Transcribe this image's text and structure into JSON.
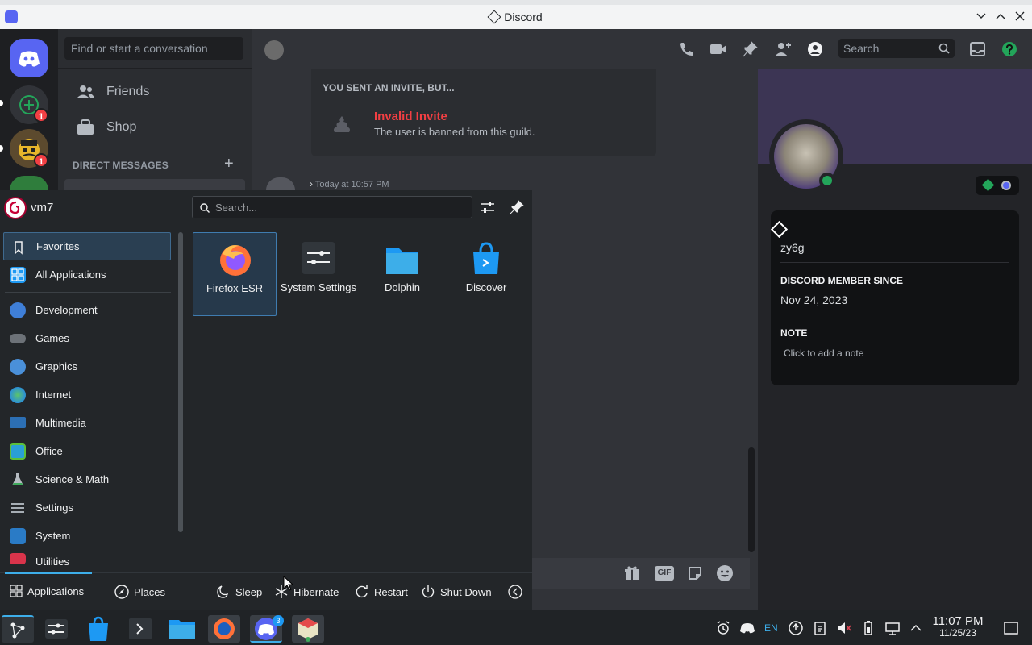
{
  "window": {
    "title": "Discord"
  },
  "dm_sidebar": {
    "search_placeholder": "Find or start a conversation",
    "friends_label": "Friends",
    "shop_label": "Shop",
    "direct_messages_heading": "DIRECT MESSAGES",
    "add_dm": "+"
  },
  "servers": {
    "badge1": "1",
    "badge2": "1"
  },
  "header": {
    "search_placeholder": "Search"
  },
  "invite": {
    "heading": "YOU SENT AN INVITE, BUT...",
    "title": "Invalid Invite",
    "subtitle": "The user is banned from this guild."
  },
  "message": {
    "timestamp": "Today at 10:57 PM"
  },
  "profile": {
    "username": "zy6g",
    "member_since_label": "DISCORD MEMBER SINCE",
    "member_since": "Nov 24, 2023",
    "note_label": "NOTE",
    "note_placeholder": "Click to add a note"
  },
  "composer": {
    "gif_label": "GIF"
  },
  "launcher": {
    "user": "vm7",
    "search_placeholder": "Search...",
    "categories": [
      {
        "label": "Favorites",
        "icon": "bookmark-icon"
      },
      {
        "label": "All Applications",
        "icon": "grid-icon"
      },
      {
        "label": "Development",
        "icon": "development-icon"
      },
      {
        "label": "Games",
        "icon": "gamepad-icon"
      },
      {
        "label": "Graphics",
        "icon": "graphics-icon"
      },
      {
        "label": "Internet",
        "icon": "globe-icon"
      },
      {
        "label": "Multimedia",
        "icon": "multimedia-icon"
      },
      {
        "label": "Office",
        "icon": "office-icon"
      },
      {
        "label": "Science & Math",
        "icon": "flask-icon"
      },
      {
        "label": "Settings",
        "icon": "settings-icon"
      },
      {
        "label": "System",
        "icon": "system-icon"
      },
      {
        "label": "Utilities",
        "icon": "utilities-icon"
      }
    ],
    "apps": [
      {
        "label": "Firefox ESR",
        "icon": "firefox-icon"
      },
      {
        "label": "System Settings",
        "icon": "system-settings-icon"
      },
      {
        "label": "Dolphin",
        "icon": "folder-icon"
      },
      {
        "label": "Discover",
        "icon": "discover-icon"
      }
    ],
    "footer": {
      "applications": "Applications",
      "places": "Places",
      "sleep": "Sleep",
      "hibernate": "Hibernate",
      "restart": "Restart",
      "shutdown": "Shut Down"
    }
  },
  "taskbar": {
    "discord_badge": "3",
    "keyboard_layout": "EN",
    "time": "11:07 PM",
    "date": "11/25/23"
  },
  "colors": {
    "discord_blurple": "#5865f2",
    "danger_red": "#f23f43",
    "online_green": "#23a55a",
    "kde_highlight": "#3daee9"
  }
}
